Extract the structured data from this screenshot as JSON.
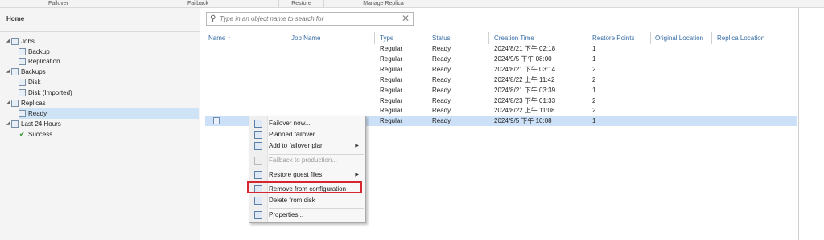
{
  "ribbon": {
    "groups": [
      "Failover",
      "Failback",
      "Restore",
      "Manage Replica"
    ]
  },
  "sidebar": {
    "home_label": "Home",
    "tree": [
      {
        "label": "Jobs",
        "level": 0,
        "expanded": true,
        "icon": "jobs-icon"
      },
      {
        "label": "Backup",
        "level": 1,
        "icon": "backup-job-icon"
      },
      {
        "label": "Replication",
        "level": 1,
        "icon": "replication-job-icon"
      },
      {
        "label": "Backups",
        "level": 0,
        "expanded": true,
        "icon": "backups-icon"
      },
      {
        "label": "Disk",
        "level": 1,
        "icon": "disk-icon"
      },
      {
        "label": "Disk (Imported)",
        "level": 1,
        "icon": "disk-imported-icon"
      },
      {
        "label": "Replicas",
        "level": 0,
        "expanded": true,
        "icon": "replicas-icon"
      },
      {
        "label": "Ready",
        "level": 1,
        "selected": true,
        "icon": "ready-icon"
      },
      {
        "label": "Last 24 Hours",
        "level": 0,
        "expanded": true,
        "icon": "last-24-hours-icon"
      },
      {
        "label": "Success",
        "level": 1,
        "icon": "success-check-icon"
      }
    ]
  },
  "search": {
    "placeholder": "Type in an object name to search for"
  },
  "table": {
    "columns": [
      "Name",
      "Job Name",
      "Type",
      "Status",
      "Creation Time",
      "Restore Points",
      "Original Location",
      "Replica Location"
    ],
    "sort_indicator": "↑",
    "rows": [
      {
        "type": "Regular",
        "status": "Ready",
        "creation_time": "2024/8/21 下午 02:18",
        "restore_points": "1"
      },
      {
        "type": "Regular",
        "status": "Ready",
        "creation_time": "2024/9/5 下午 08:00",
        "restore_points": "1"
      },
      {
        "type": "Regular",
        "status": "Ready",
        "creation_time": "2024/8/21 下午 03:14",
        "restore_points": "2"
      },
      {
        "type": "Regular",
        "status": "Ready",
        "creation_time": "2024/8/22 上午 11:42",
        "restore_points": "2"
      },
      {
        "type": "Regular",
        "status": "Ready",
        "creation_time": "2024/8/21 下午 03:39",
        "restore_points": "1"
      },
      {
        "type": "Regular",
        "status": "Ready",
        "creation_time": "2024/8/23 下午 01:33",
        "restore_points": "2"
      },
      {
        "type": "Regular",
        "status": "Ready",
        "creation_time": "2024/8/22 上午 11:08",
        "restore_points": "2"
      },
      {
        "type": "Regular",
        "status": "Ready",
        "creation_time": "2024/9/5 下午 10:08",
        "restore_points": "1",
        "selected": true
      }
    ]
  },
  "context_menu": {
    "items": [
      {
        "label": "Failover now...",
        "icon": "failover-now-icon"
      },
      {
        "label": "Planned failover...",
        "icon": "planned-failover-icon"
      },
      {
        "label": "Add to failover plan",
        "icon": "add-to-failover-plan-icon",
        "submenu": true
      },
      {
        "separator": true
      },
      {
        "label": "Failback to production...",
        "icon": "failback-icon",
        "disabled": true
      },
      {
        "separator": true
      },
      {
        "label": "Restore guest files",
        "icon": "restore-guest-files-icon",
        "submenu": true
      },
      {
        "label": "Remove from configuration",
        "icon": "remove-from-configuration-icon",
        "highlighted": true
      },
      {
        "label": "Delete from disk",
        "icon": "delete-from-disk-icon"
      },
      {
        "separator": true
      },
      {
        "label": "Properties...",
        "icon": "properties-icon"
      }
    ]
  },
  "colors": {
    "selection": "#cce1f7",
    "header_text": "#3a6ea5",
    "highlight_box": "#d6262f"
  }
}
